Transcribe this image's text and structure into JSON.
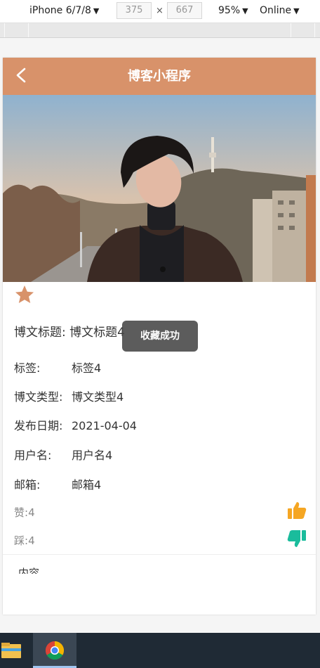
{
  "devtools": {
    "device": "iPhone 6/7/8",
    "width": "375",
    "height": "667",
    "times": "×",
    "zoom": "95%",
    "network": "Online"
  },
  "navbar": {
    "title": "博客小程序",
    "back_icon": "chevron-left-icon",
    "color": "#d8926a"
  },
  "post": {
    "favorite_icon": "star-icon",
    "title_label": "博文标题:",
    "title_value": "博文标题4",
    "fields": [
      {
        "label": "标签:",
        "value": "标签4"
      },
      {
        "label": "博文类型:",
        "value": "博文类型4"
      },
      {
        "label": "发布日期:",
        "value": "2021-04-04"
      },
      {
        "label": "用户名:",
        "value": "用户名4"
      },
      {
        "label": "邮箱:",
        "value": "邮箱4"
      }
    ],
    "likes_label": "赞:",
    "likes_value": "4",
    "like_icon": "thumbs-up-icon",
    "dislikes_label": "踩:",
    "dislikes_value": "4",
    "dislike_icon": "thumbs-down-icon",
    "content_label": "内容"
  },
  "toast": {
    "message": "收藏成功"
  },
  "taskbar": {
    "items": [
      "file-explorer-icon",
      "chrome-icon"
    ]
  },
  "colors": {
    "accent": "#d8926a",
    "like": "#f5a623",
    "dislike": "#1abc9c"
  }
}
